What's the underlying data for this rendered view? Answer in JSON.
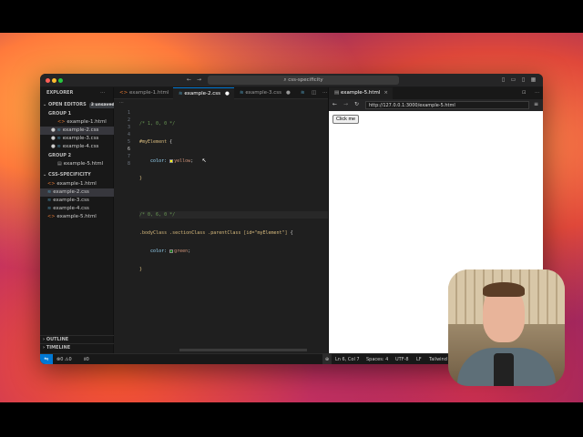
{
  "window": {
    "command_center": "css-specificity"
  },
  "sidebar": {
    "title": "EXPLORER",
    "open_editors": "OPEN EDITORS",
    "unsaved_badge": "3 unsaved",
    "group1": "GROUP 1",
    "group1_items": [
      "example-1.html",
      "example-2.css",
      "example-3.css",
      "example-4.css"
    ],
    "group2": "GROUP 2",
    "group2_items": [
      "example-5.html"
    ],
    "project": "CSS-SPECIFICITY",
    "project_items": [
      "example-1.html",
      "example-2.css",
      "example-3.css",
      "example-4.css",
      "example-5.html"
    ],
    "outline": "OUTLINE",
    "timeline": "TIMELINE"
  },
  "editor": {
    "tabs": [
      "example-1.html",
      "example-2.css",
      "example-3.css"
    ],
    "line_numbers": [
      "1",
      "2",
      "3",
      "4",
      "5",
      "6",
      "7",
      "8"
    ],
    "code": {
      "l1": "/* 1, 0, 0 */",
      "l2_sel": "#myElement",
      "l2_brace": " {",
      "l3_prop": "color:",
      "l3_val": "yellow",
      "l3_end": ";",
      "l4": "}",
      "l6": "/* 0, 6, 0 */",
      "l7_sel": ".bodyClass .sectionClass .parentClass [id=\"myElement\"]",
      "l7_brace": " {",
      "l8_prop": "color:",
      "l8_val": "green",
      "l8_end": ";",
      "l9": "}"
    },
    "swatch_colors": {
      "yellow": "#ffff00",
      "green": "#008000"
    }
  },
  "preview": {
    "tab": "example-5.html",
    "url": "http://127.0.0.1:3000/example-5.html",
    "button": "Click me"
  },
  "statusbar": {
    "errors": "0",
    "warnings": "0",
    "ports": "0",
    "position": "Ln 6, Col 7",
    "spaces": "Spaces: 4",
    "encoding": "UTF-8",
    "eol": "LF",
    "language": "Tailwind"
  }
}
